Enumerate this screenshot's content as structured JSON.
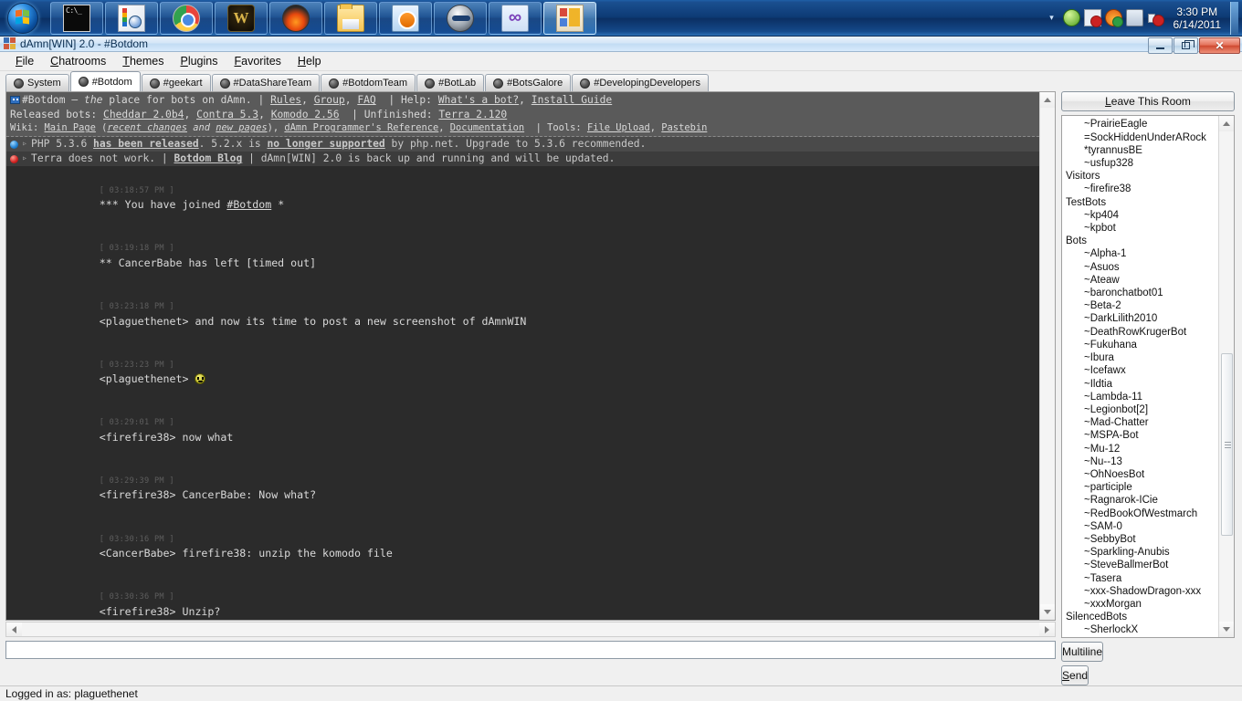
{
  "taskbar": {
    "start_label": "Start",
    "buttons": [
      {
        "name": "command-prompt",
        "icon": "cmd-icon",
        "active": false
      },
      {
        "name": "paint",
        "icon": "paint-icon",
        "active": false
      },
      {
        "name": "google-chrome",
        "icon": "chrome-icon",
        "active": false
      },
      {
        "name": "world-of-warcraft",
        "icon": "wow-icon",
        "active": false
      },
      {
        "name": "firefox",
        "icon": "firefox-icon",
        "active": false
      },
      {
        "name": "windows-explorer",
        "icon": "folder-icon",
        "active": false
      },
      {
        "name": "windows-media-player",
        "icon": "media-player-icon",
        "active": false
      },
      {
        "name": "mask-app",
        "icon": "mask-icon",
        "active": false
      },
      {
        "name": "visual-studio",
        "icon": "infinity-icon",
        "active": false
      },
      {
        "name": "damn-win",
        "icon": "damn-icon",
        "active": true
      }
    ],
    "tray": {
      "chevron": "▾",
      "icons": [
        "green-pill-icon",
        "network-error-icon",
        "flame-ok-icon",
        "monitor-icon",
        "speaker-muted-icon"
      ],
      "time": "3:30 PM",
      "date": "6/14/2011"
    }
  },
  "window": {
    "title": "dAmn[WIN] 2.0 - #Botdom",
    "icon": "damn-window-icon",
    "minimize": "–",
    "maximize": "□",
    "close": "✕"
  },
  "menubar": {
    "items": [
      {
        "label": "File",
        "accel": "F"
      },
      {
        "label": "Chatrooms",
        "accel": "C"
      },
      {
        "label": "Themes",
        "accel": "T"
      },
      {
        "label": "Plugins",
        "accel": "P"
      },
      {
        "label": "Favorites",
        "accel": "F"
      },
      {
        "label": "Help",
        "accel": "H"
      }
    ]
  },
  "tabs": [
    {
      "label": "System",
      "selected": false
    },
    {
      "label": "#Botdom",
      "selected": true
    },
    {
      "label": "#geekart",
      "selected": false
    },
    {
      "label": "#DataShareTeam",
      "selected": false
    },
    {
      "label": "#BotdomTeam",
      "selected": false
    },
    {
      "label": "#BotLab",
      "selected": false
    },
    {
      "label": "#BotsGalore",
      "selected": false
    },
    {
      "label": "#DevelopingDevelopers",
      "selected": false
    }
  ],
  "chat_header": {
    "topic_line1_pre": "#Botdom — ",
    "topic_line1_ital": "the",
    "topic_line1_mid": " place for bots on dAmn.  |  ",
    "topic_links1": [
      "Rules",
      "Group",
      "FAQ"
    ],
    "topic_help_label": "Help: ",
    "topic_help_links": [
      "What's a bot?",
      "Install Guide"
    ],
    "line2_pre": "Released bots: ",
    "line2_links": [
      "Cheddar 2.0b4",
      "Contra 5.3",
      "Komodo 2.56"
    ],
    "line2_unfinished_label": "Unfinished: ",
    "line2_unfinished_link": "Terra 2.120",
    "wiki_label": "Wiki: ",
    "wiki_links": [
      "Main Page",
      "recent changes",
      "new pages",
      "dAmn Programmer's Reference",
      "Documentation"
    ],
    "tools_label": "Tools: ",
    "tools_links": [
      "File Upload",
      "Pastebin"
    ],
    "notices": [
      {
        "bullet": "blue",
        "pre": "PHP 5.3.6 ",
        "bold_link": "has been released",
        "mid": ". 5.2.x is ",
        "link2": "no longer supported",
        "post": " by php.net. Upgrade to 5.3.6 recommended."
      },
      {
        "bullet": "red",
        "pre": "Terra does not work.  |  ",
        "bold_link": "Botdom Blog",
        "mid": "  |  dAmn[WIN] 2.0 is back up and running and will be updated.",
        "link2": "",
        "post": ""
      }
    ]
  },
  "messages": [
    {
      "time": "[ 03:18:57 PM ]",
      "body": "*** You have joined ",
      "link": "#Botdom",
      "tail": " *",
      "nick": "",
      "emote": false
    },
    {
      "time": "[ 03:19:18 PM ]",
      "body": "** CancerBabe has left [timed out]",
      "link": "",
      "tail": "",
      "nick": "",
      "emote": false
    },
    {
      "time": "[ 03:23:18 PM ]",
      "nick": "<plaguethenet>",
      "body": " and now its time to post a new screenshot of dAmnWIN",
      "link": "",
      "tail": "",
      "emote": false
    },
    {
      "time": "[ 03:23:23 PM ]",
      "nick": "<plaguethenet>",
      "body": " ",
      "link": "",
      "tail": "",
      "emote": true
    },
    {
      "time": "[ 03:29:01 PM ]",
      "nick": "<firefire38>",
      "body": " now what",
      "link": "",
      "tail": "",
      "emote": false
    },
    {
      "time": "[ 03:29:39 PM ]",
      "nick": "<firefire38>",
      "body": " CancerBabe: Now what?",
      "link": "",
      "tail": "",
      "emote": false
    },
    {
      "time": "[ 03:30:16 PM ]",
      "nick": "<CancerBabe>",
      "body": " firefire38: unzip the komodo file",
      "link": "",
      "tail": "",
      "emote": false
    },
    {
      "time": "[ 03:30:36 PM ]",
      "nick": "<firefire38>",
      "body": " Unzip?",
      "link": "",
      "tail": "",
      "emote": false
    }
  ],
  "sidebar": {
    "leave_button": {
      "label": "Leave This Room",
      "accel": "L"
    },
    "userlist": [
      {
        "type": "user",
        "label": "~PrairieEagle"
      },
      {
        "type": "user",
        "label": "=SockHiddenUnderARock"
      },
      {
        "type": "user",
        "label": "*tyrannusBE"
      },
      {
        "type": "user",
        "label": "~usfup328"
      },
      {
        "type": "group",
        "label": "Visitors"
      },
      {
        "type": "user",
        "label": "~firefire38"
      },
      {
        "type": "group",
        "label": "TestBots"
      },
      {
        "type": "user",
        "label": "~kp404"
      },
      {
        "type": "user",
        "label": "~kpbot"
      },
      {
        "type": "group",
        "label": "Bots"
      },
      {
        "type": "user",
        "label": "~Alpha-1"
      },
      {
        "type": "user",
        "label": "~Asuos"
      },
      {
        "type": "user",
        "label": "~Ateaw"
      },
      {
        "type": "user",
        "label": "~baronchatbot01"
      },
      {
        "type": "user",
        "label": "~Beta-2"
      },
      {
        "type": "user",
        "label": "~DarkLilith2010"
      },
      {
        "type": "user",
        "label": "~DeathRowKrugerBot"
      },
      {
        "type": "user",
        "label": "~Fukuhana"
      },
      {
        "type": "user",
        "label": "~Ibura"
      },
      {
        "type": "user",
        "label": "~Icefawx"
      },
      {
        "type": "user",
        "label": "~Ildtia"
      },
      {
        "type": "user",
        "label": "~Lambda-11"
      },
      {
        "type": "user",
        "label": "~Legionbot[2]"
      },
      {
        "type": "user",
        "label": "~Mad-Chatter"
      },
      {
        "type": "user",
        "label": "~MSPA-Bot"
      },
      {
        "type": "user",
        "label": "~Mu-12"
      },
      {
        "type": "user",
        "label": "~Nu--13"
      },
      {
        "type": "user",
        "label": "~OhNoesBot"
      },
      {
        "type": "user",
        "label": "~participle"
      },
      {
        "type": "user",
        "label": "~Ragnarok-ICie"
      },
      {
        "type": "user",
        "label": "~RedBookOfWestmarch"
      },
      {
        "type": "user",
        "label": "~SAM-0"
      },
      {
        "type": "user",
        "label": "~SebbyBot"
      },
      {
        "type": "user",
        "label": "~Sparkling-Anubis"
      },
      {
        "type": "user",
        "label": "~SteveBallmerBot"
      },
      {
        "type": "user",
        "label": "~Tasera"
      },
      {
        "type": "user",
        "label": "~xxx-ShadowDragon-xxx"
      },
      {
        "type": "user",
        "label": "~xxxMorgan"
      },
      {
        "type": "group",
        "label": "SilencedBots"
      },
      {
        "type": "user",
        "label": "~SherlockX"
      }
    ],
    "multiline_button": {
      "label": "Multiline"
    },
    "send_button": {
      "label": "Send",
      "accel": "S"
    }
  },
  "input": {
    "value": "",
    "placeholder": ""
  },
  "statusbar": {
    "text": "Logged in as: plaguethenet"
  },
  "colors": {
    "taskbar": "#0d3a74",
    "chat_bg": "#2b2b2b",
    "header_bg": "#5a5a5a",
    "notice_bg": "#4a4a4a",
    "notice_alt_bg": "#3c3c3c",
    "chat_text": "#d9d9d9",
    "timestamp": "#5e5e5e"
  }
}
